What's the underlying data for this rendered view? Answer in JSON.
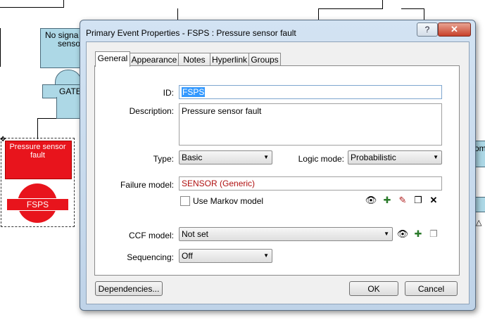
{
  "background": {
    "no_signal_text": "No signa",
    "no_signal_text2": "senso",
    "gate_label": "GATE",
    "event_title": "Pressure sensor fault",
    "event_id": "FSPS",
    "right_fragment": "om"
  },
  "dialog": {
    "title": "Primary Event Properties - FSPS : Pressure sensor fault",
    "help_glyph": "?",
    "close_glyph": "✕",
    "tabs": [
      {
        "label": "General"
      },
      {
        "label": "Appearance"
      },
      {
        "label": "Notes"
      },
      {
        "label": "Hyperlink"
      },
      {
        "label": "Groups"
      }
    ],
    "fields": {
      "id_label": "ID:",
      "id_value": "FSPS",
      "description_label": "Description:",
      "description_value": "Pressure sensor fault",
      "type_label": "Type:",
      "type_value": "Basic",
      "logic_mode_label": "Logic mode:",
      "logic_mode_value": "Probabilistic",
      "failure_model_label": "Failure model:",
      "failure_model_value": "SENSOR (Generic)",
      "markov_label": "Use Markov model",
      "ccf_label": "CCF model:",
      "ccf_value": "Not set",
      "sequencing_label": "Sequencing:",
      "sequencing_value": "Off"
    },
    "buttons": {
      "dependencies": "Dependencies...",
      "ok": "OK",
      "cancel": "Cancel"
    },
    "colors": {
      "failure_model_text": "#b01010",
      "selection": "#3399ff",
      "event_red": "#e8141c",
      "node_blue": "#add8e6"
    }
  }
}
